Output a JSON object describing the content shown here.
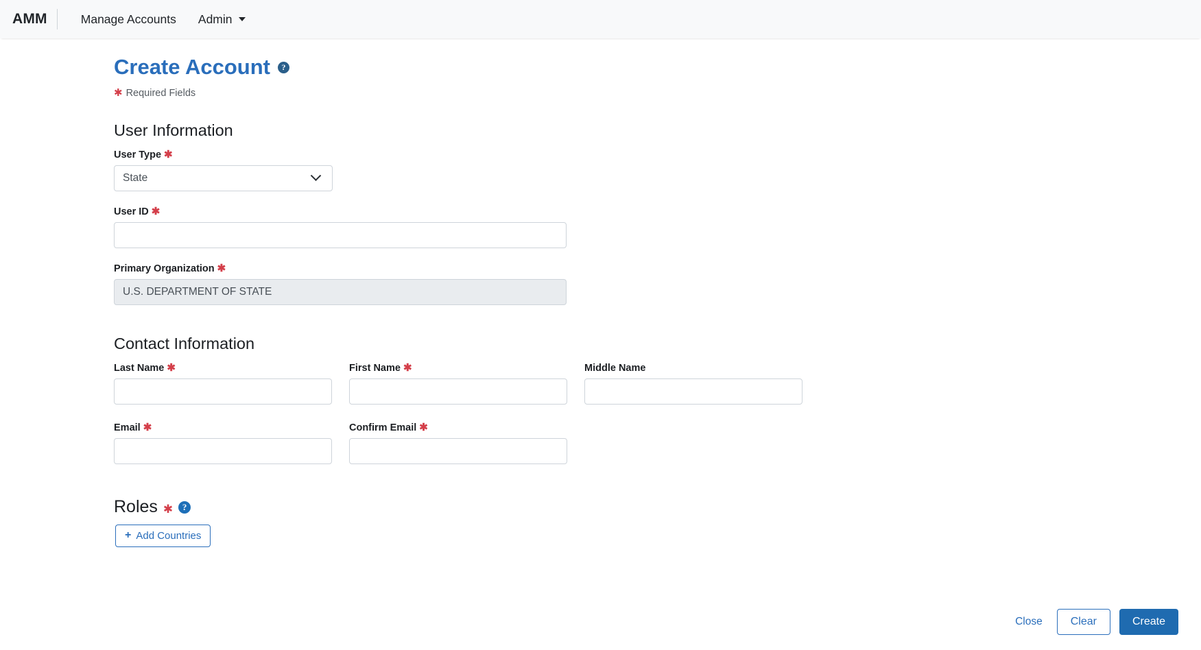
{
  "navbar": {
    "brand": "AMM",
    "items": [
      {
        "label": "Manage Accounts",
        "has_caret": false
      },
      {
        "label": "Admin",
        "has_caret": true
      }
    ]
  },
  "header": {
    "title": "Create Account",
    "help_icon": "help-circle-icon",
    "required_marker": "✱",
    "required_note": "Required Fields"
  },
  "sections": {
    "user_information": {
      "title": "User Information",
      "fields": {
        "user_type": {
          "label": "User Type",
          "required_marker": "✱",
          "value": "State",
          "icon": "chevron-down-icon"
        },
        "user_id": {
          "label": "User ID",
          "required_marker": "✱",
          "value": "",
          "placeholder": ""
        },
        "primary_organization": {
          "label": "Primary Organization",
          "required_marker": "✱",
          "value": "U.S. DEPARTMENT OF STATE",
          "readonly": true
        }
      }
    },
    "contact_information": {
      "title": "Contact Information",
      "fields": {
        "last_name": {
          "label": "Last Name",
          "required_marker": "✱",
          "value": "",
          "placeholder": ""
        },
        "first_name": {
          "label": "First Name",
          "required_marker": "✱",
          "value": "",
          "placeholder": ""
        },
        "middle_name": {
          "label": "Middle Name",
          "required_marker": "",
          "value": "",
          "placeholder": ""
        },
        "email": {
          "label": "Email",
          "required_marker": "✱",
          "value": "",
          "placeholder": ""
        },
        "confirm_email": {
          "label": "Confirm Email",
          "required_marker": "✱",
          "value": "",
          "placeholder": ""
        }
      }
    },
    "roles": {
      "title": "Roles",
      "required_marker": "✱",
      "help_icon": "help-circle-icon",
      "add_countries_label": "Add Countries",
      "add_icon": "plus-icon"
    }
  },
  "footer": {
    "close_label": "Close",
    "clear_label": "Clear",
    "create_label": "Create"
  },
  "colors": {
    "title_blue": "#2a6ebb",
    "primary_button": "#1f6bb0",
    "required_red": "#d43f4a",
    "navbar_bg": "#f8f9fa",
    "readonly_bg": "#e9ecef",
    "input_border": "#ced4da"
  }
}
